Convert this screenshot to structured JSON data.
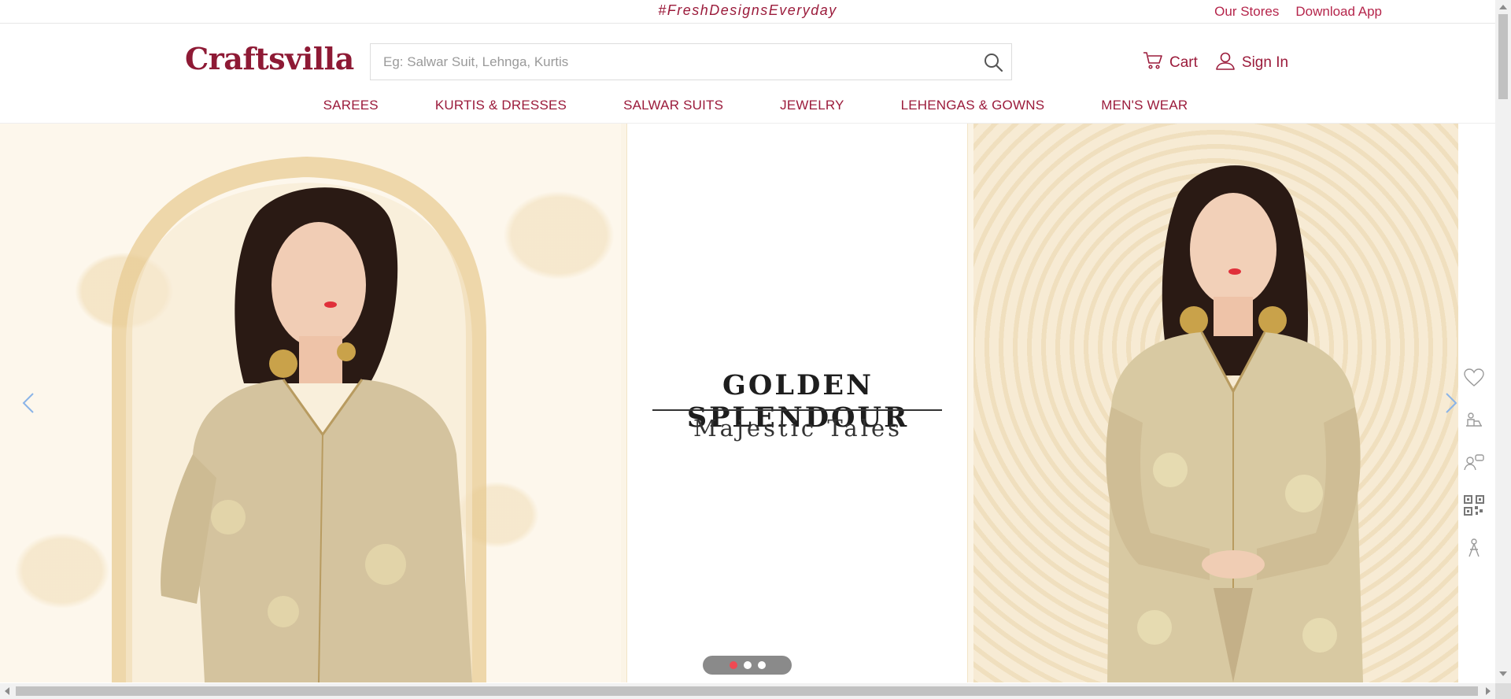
{
  "topbar": {
    "tagline": "#FreshDesignsEveryday",
    "links": [
      "Our Stores",
      "Download App"
    ]
  },
  "header": {
    "logo": "Craftsvilla",
    "search": {
      "placeholder": "Eg: Salwar Suit, Lehnga, Kurtis"
    },
    "cart_label": "Cart",
    "signin_label": "Sign In"
  },
  "nav": {
    "items": [
      "SAREES",
      "KURTIS & DRESSES",
      "SALWAR SUITS",
      "JEWELRY",
      "LEHENGAS & GOWNS",
      "MEN'S WEAR"
    ]
  },
  "hero": {
    "headline": "GOLDEN SPLENDOUR",
    "subheadline": "Majestic Tales",
    "slide_count": 3,
    "active_slide": 1
  },
  "side_icons": [
    "heart-icon",
    "track-order-icon",
    "support-icon",
    "qr-code-icon",
    "recommend-icon"
  ],
  "colors": {
    "brand": "#9b1b3b",
    "dot_active": "#f04a53"
  }
}
